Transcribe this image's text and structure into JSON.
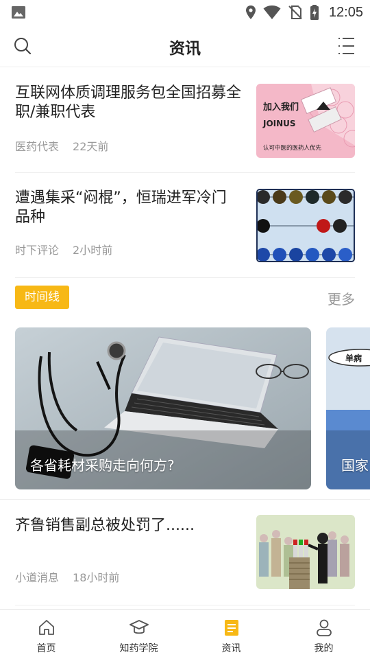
{
  "status_bar": {
    "time": "12:05",
    "icons": [
      "image-icon",
      "location-icon",
      "wifi-icon",
      "no-sim-icon",
      "battery-charging-icon"
    ]
  },
  "header": {
    "title": "资讯",
    "icons": [
      "search-icon",
      "menu-icon"
    ]
  },
  "news": [
    {
      "title": "互联网体质调理服务包全国招募全职/兼职代表",
      "source": "医药代表",
      "time": "22天前",
      "thumb": {
        "line1": "加入我们",
        "line2": "JOINUS",
        "line3": "认可中医的医药人优先"
      }
    },
    {
      "title": "遭遇集采“闷棍”，恒瑞进军冷门品种",
      "source": "时下评论",
      "time": "2小时前"
    }
  ],
  "timeline": {
    "tag": "时间线",
    "more": "更多",
    "cards": [
      {
        "caption": "各省耗材采购走向何方?"
      },
      {
        "caption": "国家",
        "badge": "单病"
      }
    ]
  },
  "news_bottom": {
    "title": "齐鲁销售副总被处罚了......",
    "source": "小道消息",
    "time": "18小时前"
  },
  "tabs": [
    {
      "label": "首页",
      "icon": "home-icon"
    },
    {
      "label": "知药学院",
      "icon": "graduation-cap-icon"
    },
    {
      "label": "资讯",
      "icon": "news-icon",
      "active": true
    },
    {
      "label": "我的",
      "icon": "user-icon"
    }
  ],
  "colors": {
    "accent": "#f7b815",
    "text": "#222222",
    "meta": "#999999"
  }
}
